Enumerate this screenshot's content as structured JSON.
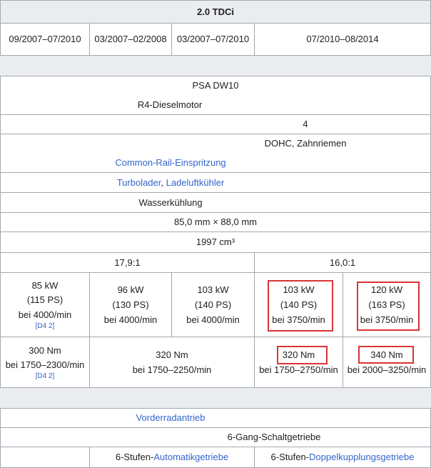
{
  "header": {
    "title": "2.0 TDCi"
  },
  "periods": [
    "09/2007–07/2010",
    "03/2007–02/2008",
    "03/2007–07/2010",
    "07/2010–08/2014"
  ],
  "engine": "PSA DW10",
  "type": "R4-Dieselmotor",
  "valves": "4",
  "valvetrain": "DOHC, Zahnriemen",
  "injection": "Common-Rail-Einspritzung",
  "charging": {
    "a": "Turbolader",
    "sep": ", ",
    "b": "Ladeluftkühler"
  },
  "cooling": "Wasserkühlung",
  "bore_stroke": "85,0 mm × 88,0 mm",
  "displacement": "1997 cm³",
  "compression": [
    "17,9:1",
    "16,0:1"
  ],
  "power": [
    {
      "kw": "85 kW",
      "ps": "(115 PS)",
      "rpm": "bei 4000/min",
      "ref": "[D4 2]"
    },
    {
      "kw": "96 kW",
      "ps": "(130 PS)",
      "rpm": "bei 4000/min"
    },
    {
      "kw": "103 kW",
      "ps": "(140 PS)",
      "rpm": "bei 4000/min"
    },
    {
      "kw": "103 kW",
      "ps": "(140 PS)",
      "rpm": "bei 3750/min"
    },
    {
      "kw": "120 kW",
      "ps": "(163 PS)",
      "rpm": "bei 3750/min"
    }
  ],
  "torque": [
    {
      "nm": "300 Nm",
      "rpm": "bei 1750–2300/min",
      "ref": "[D4 2]"
    },
    {
      "nm": "320 Nm",
      "rpm": "bei 1750–2250/min"
    },
    {
      "nm": "320 Nm",
      "rpm": "bei 1750–2750/min"
    },
    {
      "nm": "340 Nm",
      "rpm": "bei 2000–3250/min"
    }
  ],
  "drive": "Vorderradantrieb",
  "gearbox_manual": "6-Gang-Schaltgetriebe",
  "gearbox_auto": {
    "prefix": "6-Stufen-",
    "link": "Automatikgetriebe"
  },
  "gearbox_dct": {
    "prefix": "6-Stufen-",
    "link": "Doppelkupplungsgetriebe"
  },
  "colors": {
    "link": "#3366cc",
    "border": "#a2a9b1",
    "header_bg": "#eaecf0",
    "highlight": "#d93434"
  }
}
